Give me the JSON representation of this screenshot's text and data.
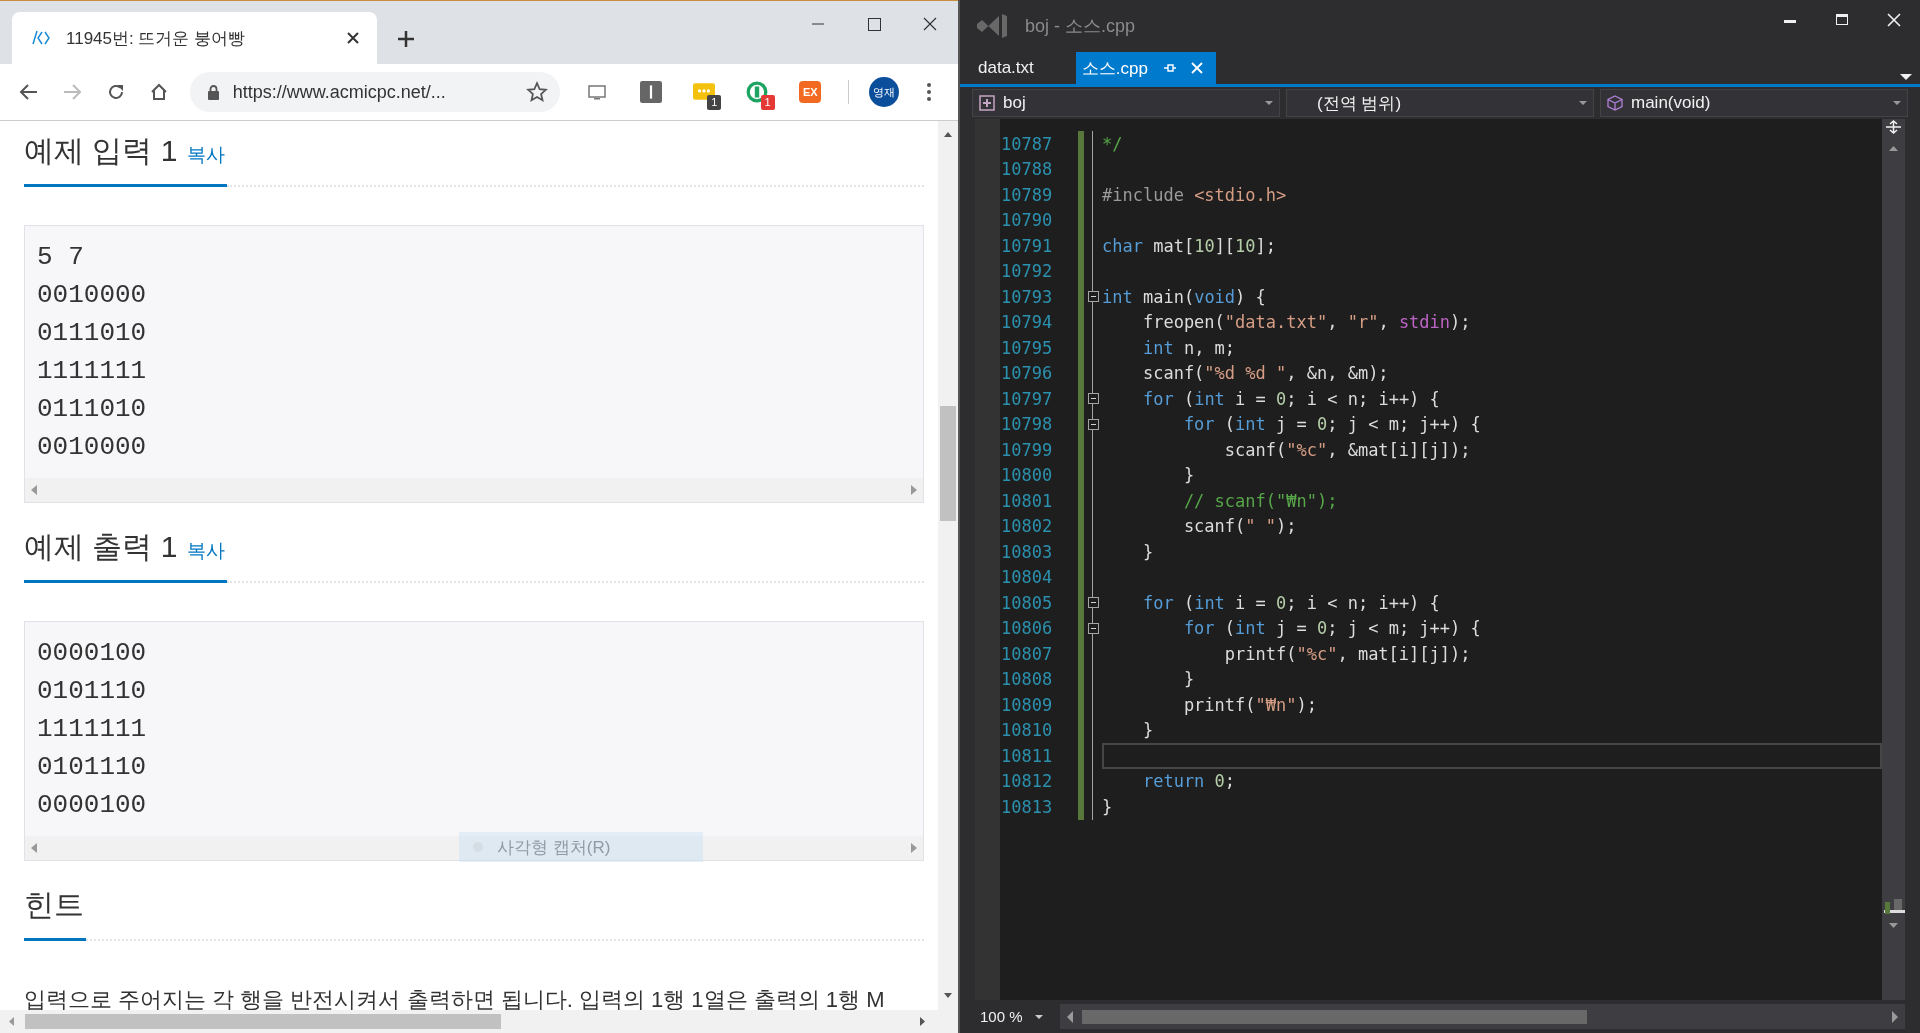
{
  "browser": {
    "tab": {
      "title": "11945번: 뜨거운 붕어빵"
    },
    "address": {
      "url": "https://www.acmicpc.net/..."
    },
    "extensions": [
      {
        "kind": "screen"
      },
      {
        "kind": "bar"
      },
      {
        "kind": "dots",
        "badge": "1"
      },
      {
        "kind": "ring",
        "badge": "1"
      },
      {
        "kind": "ex",
        "label": "EX"
      }
    ],
    "profile": {
      "label": "영재"
    }
  },
  "page": {
    "sections": [
      {
        "kind": "sample",
        "title": "예제 입력 1",
        "copy_link": "복사",
        "lines": [
          "5 7",
          "0010000",
          "0111010",
          "1111111",
          "0111010",
          "0010000"
        ]
      },
      {
        "kind": "sample",
        "title": "예제 출력 1",
        "copy_link": "복사",
        "lines": [
          "0000100",
          "0101110",
          "1111111",
          "0101110",
          "0000100"
        ]
      },
      {
        "kind": "text",
        "title": "힌트",
        "paragraph": "입력으로 주어지는 각 행을 반전시켜서 출력하면 됩니다. 입력의 1행 1열은 출력의 1행 M"
      }
    ],
    "capture_tooltip": "사각형 캡처(R)"
  },
  "editor": {
    "title": "boj - 소스.cpp",
    "tabs": [
      {
        "label": "data.txt",
        "selected": false
      },
      {
        "label": "소스.cpp",
        "selected": true
      }
    ],
    "navigation": {
      "project": "boj",
      "scope": "(전역 범위)",
      "member": "main(void)"
    },
    "lines": [
      {
        "number": "10787",
        "fold": false,
        "current": false,
        "tokens": [
          {
            "kind": "comment",
            "text": "*/"
          }
        ]
      },
      {
        "number": "10788",
        "fold": false,
        "current": false
      },
      {
        "number": "10789",
        "fold": false,
        "current": false,
        "tokens": [
          {
            "kind": "preproc",
            "text": "#include "
          },
          {
            "kind": "string",
            "text": "<stdio.h>"
          }
        ]
      },
      {
        "number": "10790",
        "fold": false,
        "current": false
      },
      {
        "number": "10791",
        "fold": false,
        "current": false,
        "tokens": [
          {
            "kind": "keyword",
            "text": "char"
          },
          {
            "kind": "plain",
            "text": " mat["
          },
          {
            "kind": "number",
            "text": "10"
          },
          {
            "kind": "plain",
            "text": "]["
          },
          {
            "kind": "number",
            "text": "10"
          },
          {
            "kind": "plain",
            "text": "];"
          }
        ]
      },
      {
        "number": "10792",
        "fold": false,
        "current": false
      },
      {
        "number": "10793",
        "fold": true,
        "current": false,
        "tokens": [
          {
            "kind": "keyword",
            "text": "int"
          },
          {
            "kind": "plain",
            "text": " main("
          },
          {
            "kind": "keyword",
            "text": "void"
          },
          {
            "kind": "plain",
            "text": ") {"
          }
        ]
      },
      {
        "number": "10794",
        "fold": false,
        "current": false,
        "tokens": [
          {
            "kind": "plain",
            "text": "    freopen("
          },
          {
            "kind": "string",
            "text": "\"data.txt\""
          },
          {
            "kind": "plain",
            "text": ", "
          },
          {
            "kind": "string",
            "text": "\"r\""
          },
          {
            "kind": "plain",
            "text": ", "
          },
          {
            "kind": "macro",
            "text": "stdin"
          },
          {
            "kind": "plain",
            "text": ");"
          }
        ]
      },
      {
        "number": "10795",
        "fold": false,
        "current": false,
        "tokens": [
          {
            "kind": "keyword",
            "text": "    int"
          },
          {
            "kind": "plain",
            "text": " n, m;"
          }
        ]
      },
      {
        "number": "10796",
        "fold": false,
        "current": false,
        "tokens": [
          {
            "kind": "plain",
            "text": "    scanf("
          },
          {
            "kind": "string",
            "text": "\"%d %d \""
          },
          {
            "kind": "plain",
            "text": ", &n, &m);"
          }
        ]
      },
      {
        "number": "10797",
        "fold": true,
        "current": false,
        "tokens": [
          {
            "kind": "keyword",
            "text": "    for"
          },
          {
            "kind": "plain",
            "text": " ("
          },
          {
            "kind": "keyword",
            "text": "int"
          },
          {
            "kind": "plain",
            "text": " i = "
          },
          {
            "kind": "number",
            "text": "0"
          },
          {
            "kind": "plain",
            "text": "; i < n; i++) {"
          }
        ]
      },
      {
        "number": "10798",
        "fold": true,
        "current": false,
        "tokens": [
          {
            "kind": "keyword",
            "text": "        for"
          },
          {
            "kind": "plain",
            "text": " ("
          },
          {
            "kind": "keyword",
            "text": "int"
          },
          {
            "kind": "plain",
            "text": " j = "
          },
          {
            "kind": "number",
            "text": "0"
          },
          {
            "kind": "plain",
            "text": "; j < m; j++) {"
          }
        ]
      },
      {
        "number": "10799",
        "fold": false,
        "current": false,
        "tokens": [
          {
            "kind": "plain",
            "text": "            scanf("
          },
          {
            "kind": "string",
            "text": "\"%c\""
          },
          {
            "kind": "plain",
            "text": ", &mat[i][j]);"
          }
        ]
      },
      {
        "number": "10800",
        "fold": false,
        "current": false,
        "tokens": [
          {
            "kind": "plain",
            "text": "        }"
          }
        ]
      },
      {
        "number": "10801",
        "fold": false,
        "current": false,
        "tokens": [
          {
            "kind": "comment",
            "text": "        // scanf(\"₩n\");"
          }
        ]
      },
      {
        "number": "10802",
        "fold": false,
        "current": false,
        "tokens": [
          {
            "kind": "plain",
            "text": "        scanf("
          },
          {
            "kind": "string",
            "text": "\" \""
          },
          {
            "kind": "plain",
            "text": ");"
          }
        ]
      },
      {
        "number": "10803",
        "fold": false,
        "current": false,
        "tokens": [
          {
            "kind": "plain",
            "text": "    }"
          }
        ]
      },
      {
        "number": "10804",
        "fold": false,
        "current": false
      },
      {
        "number": "10805",
        "fold": true,
        "current": false,
        "tokens": [
          {
            "kind": "keyword",
            "text": "    for"
          },
          {
            "kind": "plain",
            "text": " ("
          },
          {
            "kind": "keyword",
            "text": "int"
          },
          {
            "kind": "plain",
            "text": " i = "
          },
          {
            "kind": "number",
            "text": "0"
          },
          {
            "kind": "plain",
            "text": "; i < n; i++) {"
          }
        ]
      },
      {
        "number": "10806",
        "fold": true,
        "current": false,
        "tokens": [
          {
            "kind": "keyword",
            "text": "        for"
          },
          {
            "kind": "plain",
            "text": " ("
          },
          {
            "kind": "keyword",
            "text": "int"
          },
          {
            "kind": "plain",
            "text": " j = "
          },
          {
            "kind": "number",
            "text": "0"
          },
          {
            "kind": "plain",
            "text": "; j < m; j++) {"
          }
        ]
      },
      {
        "number": "10807",
        "fold": false,
        "current": false,
        "tokens": [
          {
            "kind": "plain",
            "text": "            printf("
          },
          {
            "kind": "string",
            "text": "\"%c\""
          },
          {
            "kind": "plain",
            "text": ", mat[i][j]);"
          }
        ]
      },
      {
        "number": "10808",
        "fold": false,
        "current": false,
        "tokens": [
          {
            "kind": "plain",
            "text": "        }"
          }
        ]
      },
      {
        "number": "10809",
        "fold": false,
        "current": false,
        "tokens": [
          {
            "kind": "plain",
            "text": "        printf("
          },
          {
            "kind": "string",
            "text": "\"₩n\""
          },
          {
            "kind": "plain",
            "text": ");"
          }
        ]
      },
      {
        "number": "10810",
        "fold": false,
        "current": false,
        "tokens": [
          {
            "kind": "plain",
            "text": "    }"
          }
        ]
      },
      {
        "number": "10811",
        "fold": false,
        "current": true
      },
      {
        "number": "10812",
        "fold": false,
        "current": false,
        "tokens": [
          {
            "kind": "keyword",
            "text": "    return "
          },
          {
            "kind": "number",
            "text": "0"
          },
          {
            "kind": "plain",
            "text": ";"
          }
        ]
      },
      {
        "number": "10813",
        "fold": false,
        "current": false,
        "tokens": [
          {
            "kind": "plain",
            "text": "}"
          }
        ]
      }
    ],
    "zoom": "100 %"
  }
}
